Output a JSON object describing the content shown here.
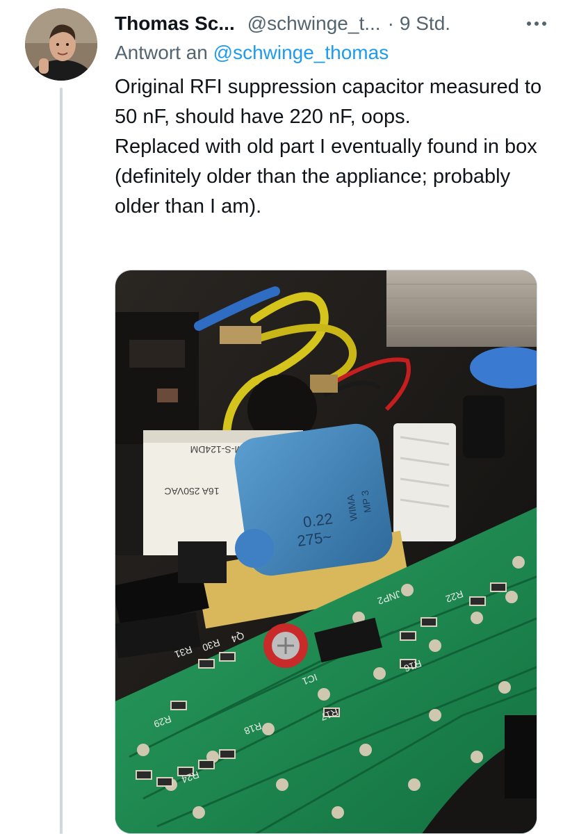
{
  "tweet": {
    "display_name": "Thomas Sc...",
    "handle": "@schwinge_t...",
    "separator": "·",
    "time": "9 Std.",
    "reply_prefix": "Antwort an",
    "reply_handle": "@schwinge_thomas",
    "text": "Original RFI suppression capacitor measured to 50 nF, should have 220 nF, oops.\nReplaced with old part I eventually found in box (definitely older than the appliance; probably older than I am)."
  },
  "photo": {
    "capacitor_value": "0.22",
    "capacitor_voltage": "275~",
    "capacitor_brand": "WIMA",
    "capacitor_series": "MP 3",
    "relay_model": "SM-S-124DM",
    "relay_rating": "16A 250VAC",
    "pcb_labels": [
      "R31",
      "R30",
      "Q4",
      "IC1",
      "R29",
      "R17",
      "JNP2",
      "R16",
      "R18",
      "R22",
      "R24"
    ]
  },
  "colors": {
    "link": "#1d9bf0",
    "secondary_text": "#536471",
    "thread_line": "#cfd9de",
    "pcb_green": "#1d8a4a"
  },
  "icons": {
    "more": "more-horizontal-icon"
  }
}
